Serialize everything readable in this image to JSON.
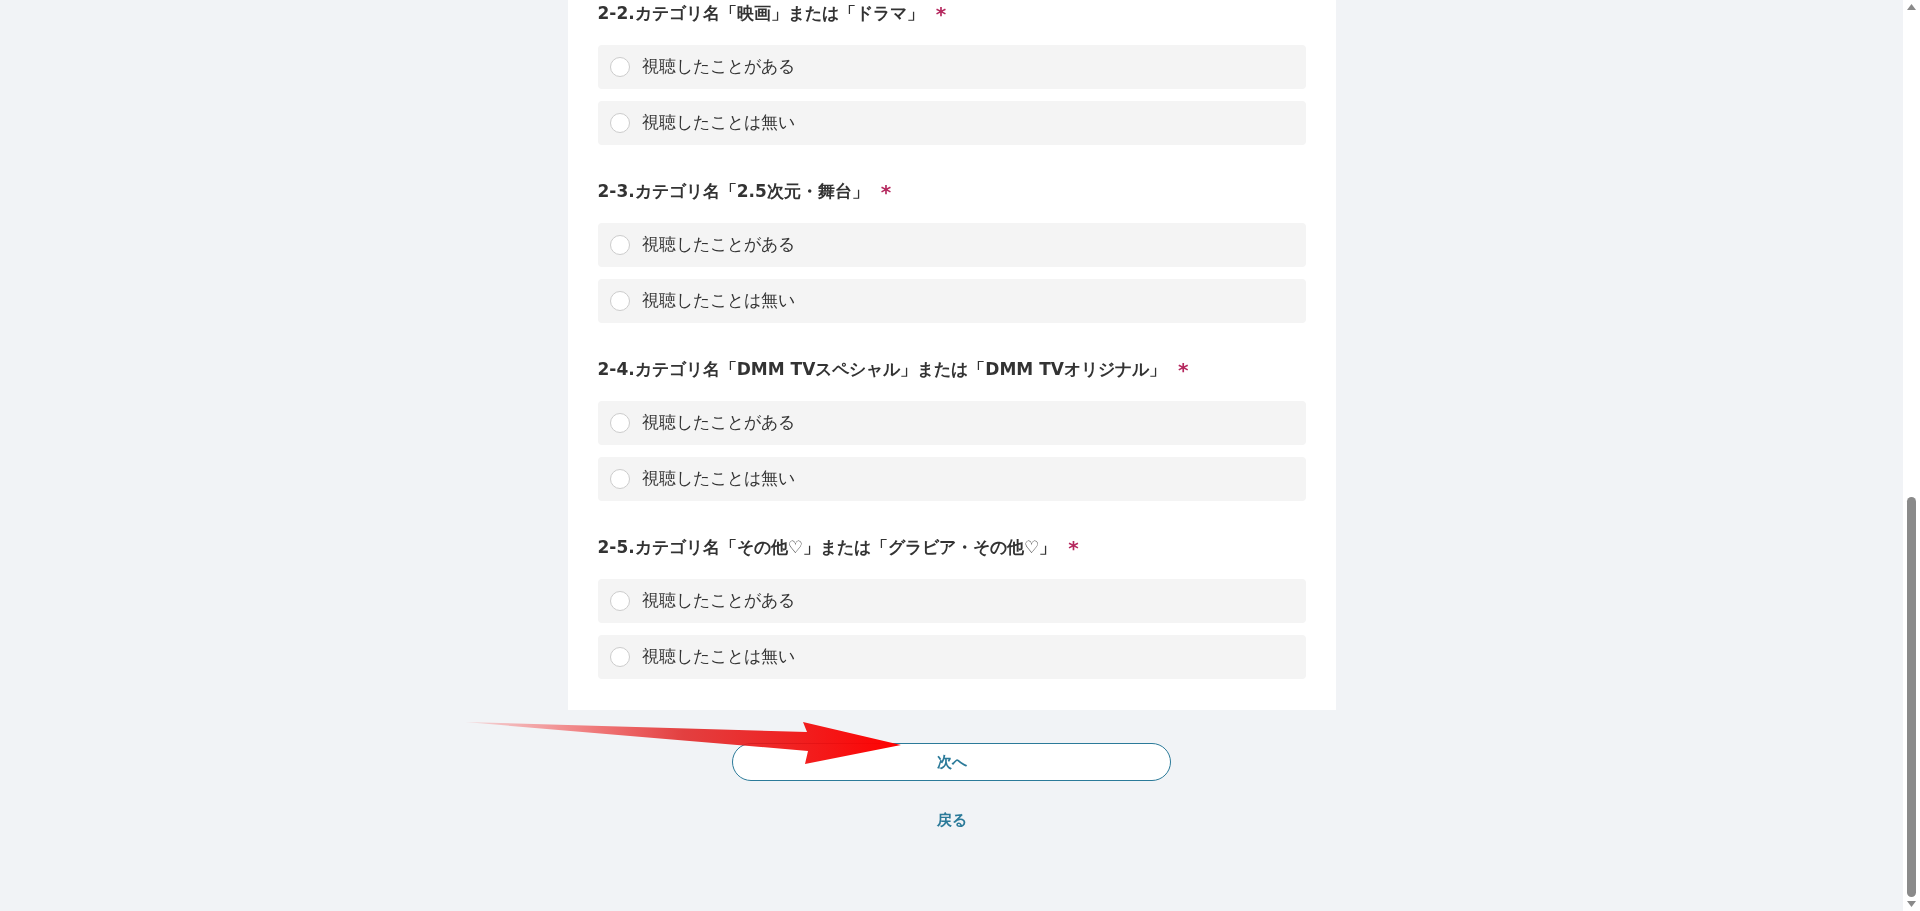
{
  "questions": [
    {
      "title": "2-2.カテゴリ名「映画」または「ドラマ」",
      "required": true,
      "options": [
        {
          "label": "視聴したことがある",
          "selected": false
        },
        {
          "label": "視聴したことは無い",
          "selected": false
        }
      ]
    },
    {
      "title": "2-3.カテゴリ名「2.5次元・舞台」",
      "required": true,
      "options": [
        {
          "label": "視聴したことがある",
          "selected": false
        },
        {
          "label": "視聴したことは無い",
          "selected": false
        }
      ]
    },
    {
      "title": "2-4.カテゴリ名「DMM TVスペシャル」または「DMM TVオリジナル」",
      "required": true,
      "options": [
        {
          "label": "視聴したことがある",
          "selected": false
        },
        {
          "label": "視聴したことは無い",
          "selected": false
        }
      ]
    },
    {
      "title": "2-5.カテゴリ名「その他♡」または「グラビア・その他♡」",
      "required": true,
      "options": [
        {
          "label": "視聴したことがある",
          "selected": false
        },
        {
          "label": "視聴したことは無い",
          "selected": false
        }
      ]
    }
  ],
  "required_mark": "*",
  "next_button": "次へ",
  "back_link": "戻る"
}
